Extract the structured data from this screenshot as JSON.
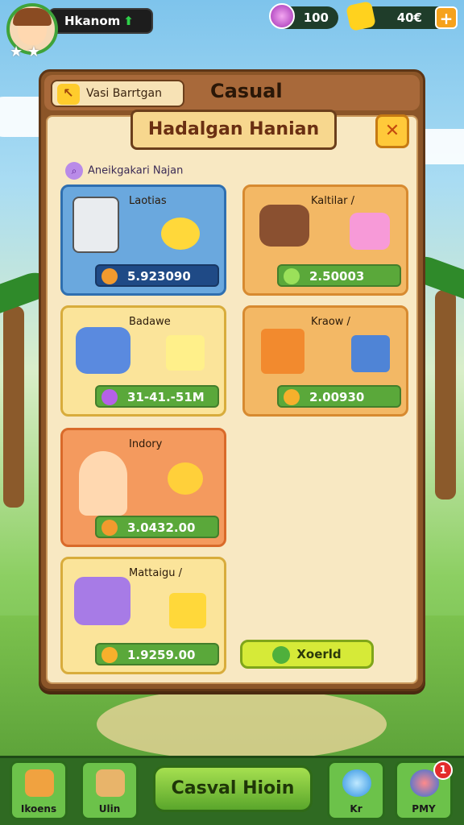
{
  "player": {
    "name": "Hkanom",
    "status_icon": "arrow-up-icon"
  },
  "currency": {
    "gems": "100",
    "coins": "40€",
    "plus_label": "+"
  },
  "panel": {
    "back_label": "Vasi Barrtgan",
    "category": "Casual",
    "title": "Hadalgan Hanian",
    "close_label": "✕",
    "subtitle": "Aneikgakari Najan"
  },
  "cards": [
    {
      "label": "Laotias",
      "price": "5.923090"
    },
    {
      "label": "Kaltilar /",
      "price": "2.50003"
    },
    {
      "label": "Badawe",
      "price": "31-41.-51M"
    },
    {
      "label": "Kraow /",
      "price": "2.00930"
    },
    {
      "label": "Indory",
      "price": "3.0432.00"
    },
    {
      "label": "Mattaigu /",
      "price": "1.9259.00"
    }
  ],
  "free_button": {
    "label": "Xoerld"
  },
  "bottom_nav": {
    "left1": "Ikoens",
    "left2": "Ulin",
    "main": "Casval Hioin",
    "right1": "Kr",
    "right2": "PMY",
    "badge": "1"
  },
  "colors": {
    "accent": "#6cc24a",
    "panel": "#8b5528",
    "banner": "#f7d78e"
  }
}
